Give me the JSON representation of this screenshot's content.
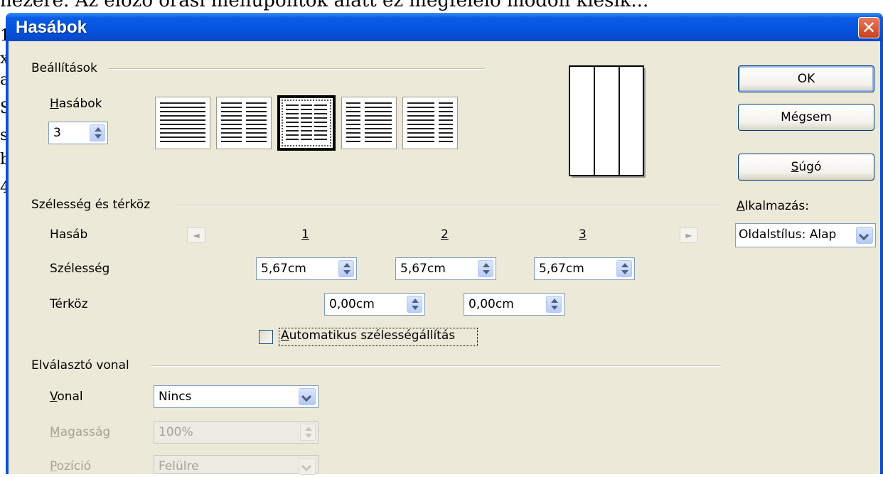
{
  "background": {
    "text_line": "hezére. Az előző órási menüpontok alatt ez megfelelő módon kiesik...",
    "side_chars": [
      "1",
      "x",
      "a",
      "S",
      "s",
      "b",
      "4"
    ]
  },
  "window": {
    "title": "Hasábok",
    "close_glyph": "✕",
    "title_color": "#0553dd"
  },
  "settings": {
    "group_label": "Beállítások",
    "columns_label": "Hasábok",
    "columns_value": "3",
    "presets": [
      {
        "name": "1 hasáb",
        "cols": 1,
        "selected": false
      },
      {
        "name": "2 hasáb",
        "cols": 2,
        "selected": false
      },
      {
        "name": "3 hasáb",
        "cols": 3,
        "selected": true
      },
      {
        "name": "2 hasáb bal keskeny",
        "cols": 2,
        "selected": false
      },
      {
        "name": "2 hasáb jobb keskeny",
        "cols": 2,
        "selected": false
      }
    ]
  },
  "width_spacing": {
    "group_label": "Szélesség és térköz",
    "column_label": "Hasáb",
    "width_label": "Szélesség",
    "spacing_label": "Térköz",
    "column_numbers": [
      "1",
      "2",
      "3"
    ],
    "widths": [
      "5,67cm",
      "5,67cm",
      "5,67cm"
    ],
    "spacings": [
      "0,00cm",
      "0,00cm"
    ],
    "auto_width_label": "Automatikus szélességállítás",
    "auto_width_checked": false,
    "prev_arrow": "◄",
    "next_arrow": "►"
  },
  "separator": {
    "group_label": "Elválasztó vonal",
    "line_label": "Vonal",
    "line_value": "Nincs",
    "height_label": "Magasság",
    "height_value": "100%",
    "position_label": "Pozíció",
    "position_value": "Felülre"
  },
  "buttons": {
    "ok": "OK",
    "cancel": "Mégsem",
    "help": "Súgó"
  },
  "apply": {
    "label": "Alkalmazás:",
    "value": "Oldalstílus: Alap"
  }
}
